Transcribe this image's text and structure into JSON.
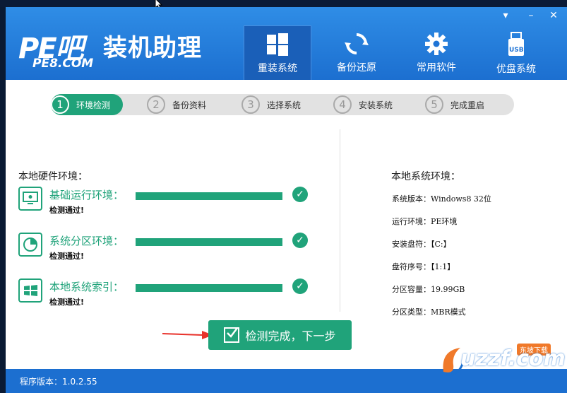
{
  "header": {
    "logo_mark": "PE吧",
    "logo_title": "装机助理",
    "logo_url": "PE8.COM",
    "nav": [
      {
        "label": "重装系统",
        "icon": "windows-icon",
        "active": true
      },
      {
        "label": "备份还原",
        "icon": "refresh-icon",
        "active": false
      },
      {
        "label": "常用软件",
        "icon": "gear-icon",
        "active": false
      },
      {
        "label": "优盘系统",
        "icon": "usb-icon",
        "active": false
      }
    ],
    "usb_text": "USB",
    "window_controls": {
      "menu": "▾",
      "minimize": "–",
      "close": "✕"
    }
  },
  "steps": [
    {
      "num": "1",
      "label": "环境检测",
      "active": true
    },
    {
      "num": "2",
      "label": "备份资料",
      "active": false
    },
    {
      "num": "3",
      "label": "选择系统",
      "active": false
    },
    {
      "num": "4",
      "label": "安装系统",
      "active": false
    },
    {
      "num": "5",
      "label": "完成重启",
      "active": false
    }
  ],
  "hardware": {
    "title": "本地硬件环境：",
    "items": [
      {
        "label": "基础运行环境：",
        "status": "检测通过!",
        "icon": "monitor-icon",
        "progress": 1.0
      },
      {
        "label": "系统分区环境：",
        "status": "检测通过!",
        "icon": "pie-chart-icon",
        "progress": 1.0
      },
      {
        "label": "本地系统索引：",
        "status": "检测通过!",
        "icon": "windows-logo-icon",
        "progress": 1.0
      }
    ]
  },
  "system": {
    "title": "本地系统环境：",
    "items": [
      "系统版本：Windows8  32位",
      "运行环境：PE环境",
      "安装盘符：【C:】",
      "盘符序号：【1:1】",
      "分区容量：19.99GB",
      "分区类型：MBR模式"
    ]
  },
  "next_button": {
    "label": "检测完成，下一步"
  },
  "footer": {
    "version": "程序版本：1.0.2.55"
  },
  "watermark": {
    "text": "uzzf.com",
    "badge": "东坡下载"
  },
  "colors": {
    "header": "#1c6fd0",
    "accent": "#20a37a",
    "arrow": "#e8322b"
  }
}
